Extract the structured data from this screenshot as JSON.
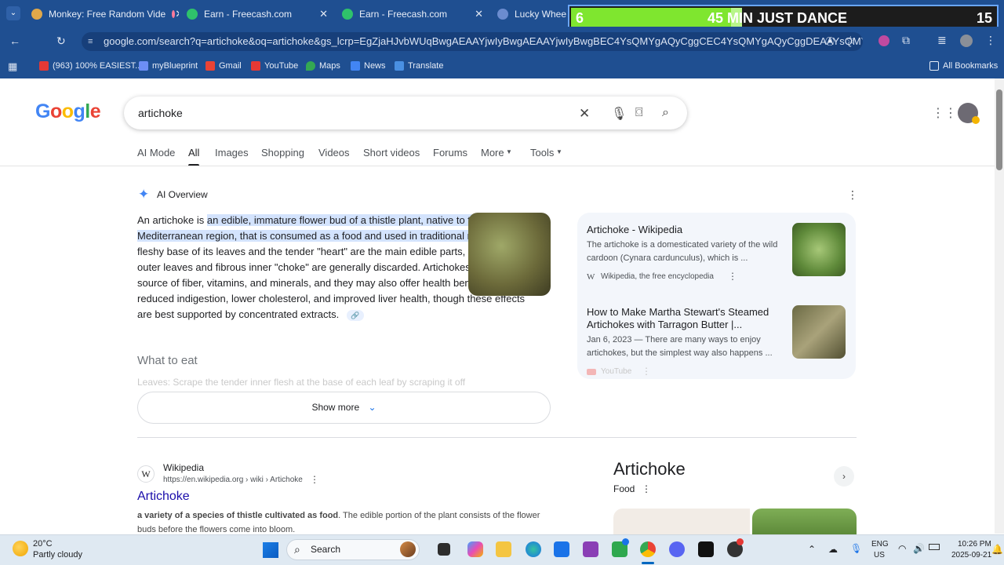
{
  "browser": {
    "tabs": [
      {
        "title": "Monkey: Free Random Vide"
      },
      {
        "title": "Earn - Freecash.com"
      },
      {
        "title": "Earn - Freecash.com"
      },
      {
        "title": "Lucky Wheel"
      }
    ],
    "url": "google.com/search?q=artichoke&oq=artichoke&gs_lcrp=EgZjaHJvbWUqBwgAEAAYjwIyBwgAEAAYjwIyBwgBEC4YsQMYgAQyCggCEC4YsQMYgAQyCggDEAAYsQMYgAQyBwgEE...",
    "bookmarks": [
      "(963) 100% EASIEST...",
      "myBlueprint",
      "Gmail",
      "YouTube",
      "Maps",
      "News",
      "Translate"
    ],
    "all_bookmarks": "All Bookmarks"
  },
  "overlay": {
    "left": "6",
    "title": "45 MIN JUST DANCE",
    "right": "15",
    "progress_fraction": 0.4
  },
  "google": {
    "logo": "Google",
    "query": "artichoke",
    "nav_tabs": [
      "AI Mode",
      "All",
      "Images",
      "Shopping",
      "Videos",
      "Short videos",
      "Forums",
      "More",
      "Tools"
    ],
    "ai_overview": {
      "label": "AI Overview",
      "p1": "An artichoke is ",
      "highlight": "an edible, immature flower bud of a thistle plant, native to the Mediterranean region, that is consumed as a food and used in traditional medicine",
      "p2": ". The fleshy base of its leaves and the tender \"heart\" are the main edible parts, while the tough outer leaves and fibrous inner \"choke\" are generally discarded. Artichokes are a good source of fiber, vitamins, and minerals, and they may also offer health benefits like reduced indigestion, lower cholesterol, and improved liver health, though these effects are best supported by concentrated extracts.",
      "what_to_eat": "What to eat",
      "faded": "Leaves: Scrape the tender inner flesh at the base of each leaf by scraping it off",
      "show_more": "Show more"
    },
    "sources": [
      {
        "title": "Artichoke - Wikipedia",
        "desc": "The artichoke is a domesticated variety of the wild cardoon (Cynara cardunculus), which is ...",
        "meta": "Wikipedia, the free encyclopedia"
      },
      {
        "title": "How to Make Martha Stewart's Steamed Artichokes with Tarragon Butter |...",
        "desc": "Jan 6, 2023 — There are many ways to enjoy artichokes, but the simplest way also happens ...",
        "meta": "YouTube"
      }
    ],
    "result": {
      "site": "Wikipedia",
      "url": "https://en.wikipedia.org › wiki › Artichoke",
      "title": "Artichoke",
      "snippet_bold": "a variety of a species of thistle cultivated as food",
      "snippet_rest": ". The edible portion of the plant consists of the flower buds before the flowers come into bloom."
    },
    "knowledge_panel": {
      "title": "Artichoke",
      "subtitle": "Food"
    }
  },
  "taskbar": {
    "temp": "20°C",
    "weather": "Partly cloudy",
    "search": "Search",
    "lang": "ENG",
    "region": "US",
    "time": "10:26 PM",
    "date": "2025-09-21"
  }
}
